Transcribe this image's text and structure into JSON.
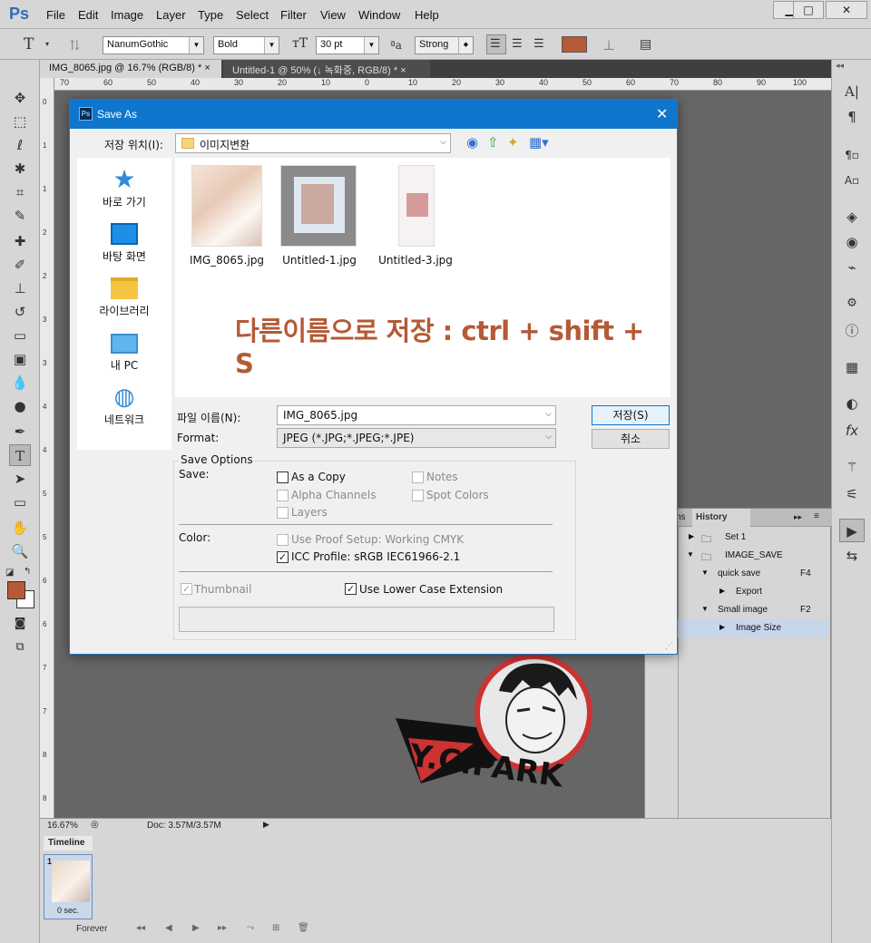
{
  "app": {
    "logo": "Ps",
    "menu": [
      "File",
      "Edit",
      "Image",
      "Layer",
      "Type",
      "Select",
      "Filter",
      "View",
      "Window",
      "Help"
    ],
    "window_buttons": [
      "▁",
      "□",
      "✕"
    ]
  },
  "options_bar": {
    "tool_glyph": "T",
    "font_family": "NanumGothic",
    "font_style": "Bold",
    "font_size": "30 pt",
    "antialias_label": "ªa",
    "antialias": "Strong",
    "text_color": "#b65b36"
  },
  "tabs": [
    {
      "label": "IMG_8065.jpg @ 16.7% (RGB/8) *",
      "close": "×"
    },
    {
      "label": "Untitled-1 @ 50% (↓ 녹화중, RGB/8) *",
      "close": "×"
    }
  ],
  "rulers": {
    "top": [
      "70",
      "60",
      "50",
      "40",
      "30",
      "20",
      "10",
      "0",
      "10",
      "20",
      "30",
      "40",
      "50",
      "60",
      "70",
      "80",
      "90",
      "100"
    ],
    "left": [
      "0",
      "1",
      "1",
      "2",
      "2",
      "3",
      "3",
      "4",
      "4",
      "5",
      "5",
      "6",
      "6",
      "7",
      "7",
      "8",
      "8"
    ]
  },
  "status": {
    "zoom": "16.67%",
    "doc": "Doc: 3.57M/3.57M"
  },
  "timeline": {
    "tab": "Timeline",
    "frame_number": "1",
    "frame_delay": "0 sec.",
    "loop": "Forever"
  },
  "history_panel": {
    "tabs": [
      "ns",
      "History"
    ],
    "rows": [
      {
        "label": "Set 1",
        "type": "set"
      },
      {
        "label": "IMAGE_SAVE",
        "type": "set-open"
      },
      {
        "label": "quick save",
        "key": "F4",
        "type": "action"
      },
      {
        "label": "Export",
        "type": "step"
      },
      {
        "label": "Small image",
        "key": "F2",
        "type": "action"
      },
      {
        "label": "Image Size",
        "type": "step-selected"
      }
    ]
  },
  "watermark": {
    "text": "Y.C.PARK"
  },
  "dialog": {
    "title": "Save As",
    "save_in_label": "저장 위치(I):",
    "save_in_value": "이미지변환",
    "nav": [
      "바로 가기",
      "바탕 화면",
      "라이브러리",
      "내 PC",
      "네트워크"
    ],
    "files": [
      "IMG_8065.jpg",
      "Untitled-1.jpg",
      "Untitled-3.jpg"
    ],
    "overlay_text": "다른이름으로 저장 : ctrl + shift + S",
    "filename_label": "파일 이름(N):",
    "filename_value": "IMG_8065.jpg",
    "format_label": "Format:",
    "format_value": "JPEG (*.JPG;*.JPEG;*.JPE)",
    "save_button": "저장(S)",
    "cancel_button": "취소",
    "save_options_title": "Save Options",
    "save_label": "Save:",
    "options": {
      "as_copy": "As a Copy",
      "notes": "Notes",
      "alpha_channels": "Alpha Channels",
      "spot_colors": "Spot Colors",
      "layers": "Layers"
    },
    "color_label": "Color:",
    "use_proof": "Use Proof Setup:  Working CMYK",
    "icc_profile": "ICC Profile:  sRGB IEC61966-2.1",
    "thumbnail": "Thumbnail",
    "lowercase_ext": "Use Lower Case Extension",
    "checked_glyph": "✓"
  }
}
